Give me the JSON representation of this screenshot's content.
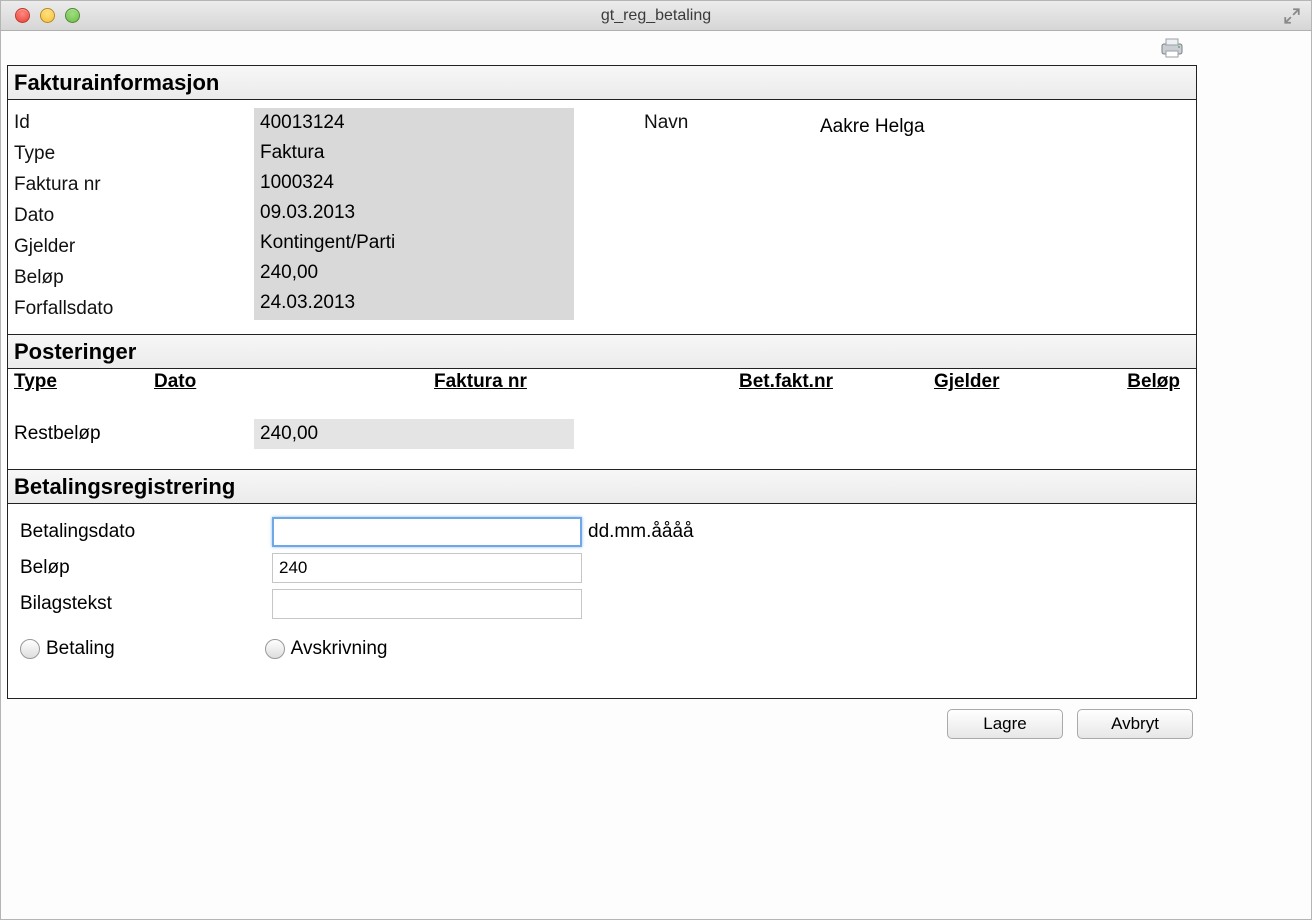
{
  "window": {
    "title": "gt_reg_betaling"
  },
  "sections": {
    "info": {
      "title": "Fakturainformasjon",
      "labels": {
        "id": "Id",
        "type": "Type",
        "faktura_nr": "Faktura nr",
        "dato": "Dato",
        "gjelder": "Gjelder",
        "belop": "Beløp",
        "forfallsdato": "Forfallsdato",
        "navn": "Navn"
      },
      "values": {
        "id": "40013124",
        "type": "Faktura",
        "faktura_nr": "1000324",
        "dato": "09.03.2013",
        "gjelder": "Kontingent/Parti",
        "belop": "240,00",
        "forfallsdato": "24.03.2013",
        "navn": "Aakre Helga"
      }
    },
    "posteringer": {
      "title": "Posteringer",
      "columns": {
        "type": "Type",
        "dato": "Dato",
        "faktura_nr": "Faktura nr",
        "bet_fakt_nr": "Bet.fakt.nr",
        "gjelder": "Gjelder",
        "belop": "Beløp"
      },
      "restbelop_label": "Restbeløp",
      "restbelop_value": "240,00"
    },
    "betaling": {
      "title": "Betalingsregistrering",
      "labels": {
        "betalingsdato": "Betalingsdato",
        "belop": "Beløp",
        "bilagstekst": "Bilagstekst"
      },
      "values": {
        "betalingsdato": "",
        "belop": "240",
        "bilagstekst": ""
      },
      "hint": "dd.mm.åååå",
      "radios": {
        "betaling": "Betaling",
        "avskrivning": "Avskrivning"
      }
    }
  },
  "buttons": {
    "lagre": "Lagre",
    "avbryt": "Avbryt"
  }
}
